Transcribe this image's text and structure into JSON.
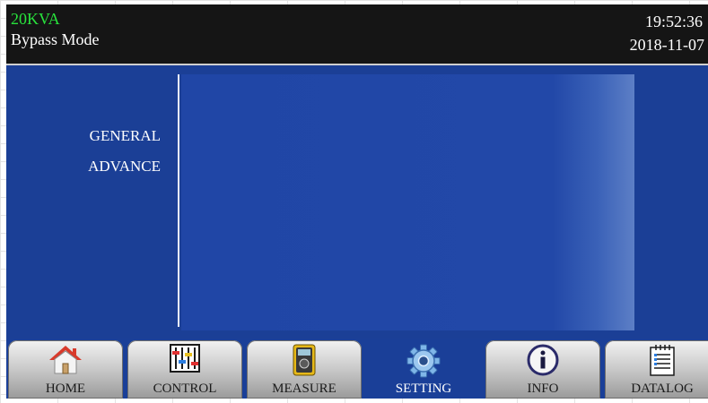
{
  "status": {
    "model": "20KVA",
    "mode": "Bypass Mode",
    "time": "19:52:36",
    "date": "2018-11-07"
  },
  "menu": {
    "items": [
      "GENERAL",
      "ADVANCE"
    ]
  },
  "tabs": [
    {
      "label": "HOME",
      "icon": "home-icon"
    },
    {
      "label": "CONTROL",
      "icon": "sliders-icon"
    },
    {
      "label": "MEASURE",
      "icon": "multimeter-icon"
    },
    {
      "label": "SETTING",
      "icon": "gear-icon",
      "active": true
    },
    {
      "label": "INFO",
      "icon": "info-icon"
    },
    {
      "label": "DATALOG",
      "icon": "notebook-icon"
    }
  ],
  "colors": {
    "background": "#1a3f98",
    "status_bar": "#151515",
    "model_text": "#28e33c"
  }
}
